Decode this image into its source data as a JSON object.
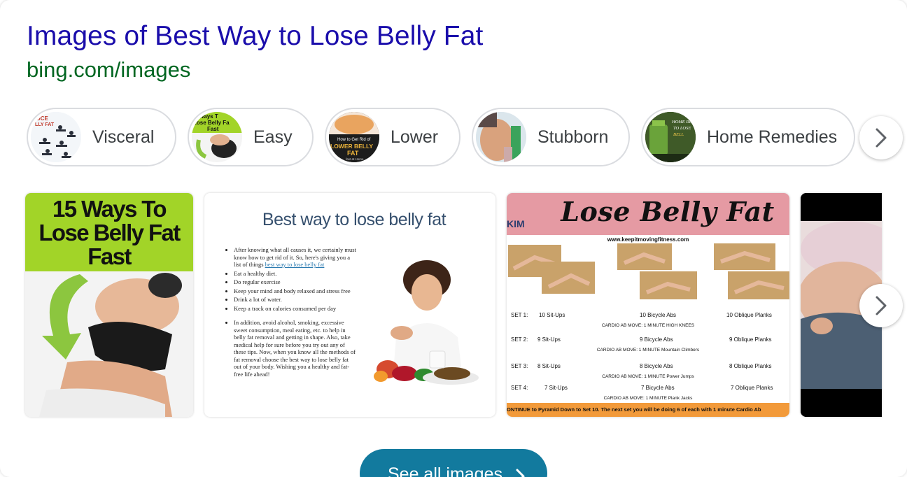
{
  "header": {
    "title": "Images of Best Way to Lose Belly Fat",
    "url": "bing.com/images"
  },
  "chips": [
    {
      "label": "Visceral",
      "thumb_text": "UCE LLY FAT"
    },
    {
      "label": "Easy",
      "thumb_text": "Ways T Lose Belly Fa Fast"
    },
    {
      "label": "Lower",
      "thumb_text": "How to Get Rid of LOWER BELLY FAT fast at Home"
    },
    {
      "label": "Stubborn"
    },
    {
      "label": "Home Remedies",
      "thumb_text": "HOME REMEDI TO LOSE BELL"
    }
  ],
  "tiles": {
    "t1": {
      "headline": "15 Ways To Lose Belly Fat Fast"
    },
    "t2": {
      "heading": "Best way to lose belly fat",
      "bullets": [
        "After knowing what all causes it, we certainly must know how to get rid of it. So, here's giving you a list of things",
        "best way to lose belly fat",
        "Eat a healthy diet.",
        "Do regular exercise",
        "Keep your mind and body relaxed and stress free",
        "Drink a lot of water.",
        "Keep a track on calories consumed per day",
        "In addition, avoid alcohol, smoking, excessive sweet consumption, meal eating, etc. to help in belly fat removal and getting in shape. Also, take medical help for sure before you try out any of these tips. Now, when you know all the methods of fat removal choose the best way to lose belly fat out of your body. Wishing you a healthy and fat- free life ahead!"
      ]
    },
    "t3": {
      "title": "Lose Belly Fat",
      "logo": "KIM",
      "site": "www.keepitmovingfitness.com",
      "sets": [
        {
          "set": "SET 1:",
          "a": "10 Sit-Ups",
          "b": "10 Bicycle Abs",
          "c": "10 Oblique Planks",
          "cardio": "CARDIO AB MOVE: 1 MINUTE  HIGH KNEES"
        },
        {
          "set": "SET 2:",
          "a": "9 Sit-Ups",
          "b": "9 Bicycle Abs",
          "c": "9 Oblique Planks",
          "cardio": "CARDIO AB MOVE: 1 MINUTE  Mountain Climbers"
        },
        {
          "set": "SET 3:",
          "a": "8 Sit-Ups",
          "b": "8 Bicycle Abs",
          "c": "8 Oblique Planks",
          "cardio": "CARDIO AB MOVE: 1 MINUTE  Power Jumps"
        },
        {
          "set": "SET 4:",
          "a": "7 Sit-Ups",
          "b": "7 Bicycle Abs",
          "c": "7 Oblique Planks",
          "cardio": "CARDIO AB MOVE: 1 MINUTE  Plank Jacks"
        }
      ],
      "footer": "ONTINUE to Pyramid Down to Set 10. The next set you will be doing 6 of each with 1 minute Cardio Ab"
    }
  },
  "see_all": {
    "label": "See all images"
  },
  "colors": {
    "title": "#1a0dab",
    "url": "#006621",
    "button": "#127a9e"
  },
  "icons": {
    "chip_next": "chevron-right-icon",
    "image_next": "chevron-right-icon",
    "see_all": "chevron-right-icon"
  }
}
